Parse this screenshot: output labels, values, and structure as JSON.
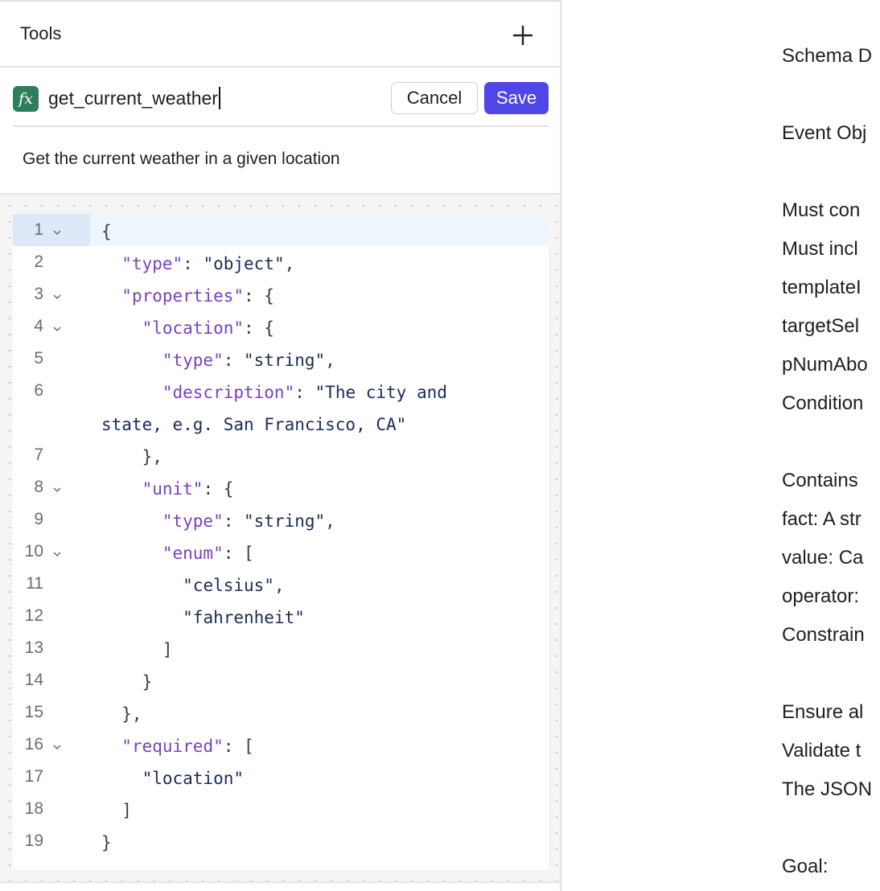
{
  "tools_panel": {
    "title": "Tools",
    "add_icon": "plus-icon",
    "function_icon": "fx-icon",
    "function_icon_glyph": "fx",
    "function_name": "get_current_weather",
    "cancel_label": "Cancel",
    "save_label": "Save",
    "description": "Get the current weather in a given location",
    "accent_color": "#4f46e5",
    "fx_color": "#2e7d5b"
  },
  "code_editor": {
    "lines": [
      {
        "num": "1",
        "fold": true,
        "active": true,
        "tokens": [
          [
            "pun",
            "{"
          ]
        ]
      },
      {
        "num": "2",
        "fold": false,
        "tokens": [
          [
            "pun",
            "  "
          ],
          [
            "key",
            "\"type\""
          ],
          [
            "pun",
            ": "
          ],
          [
            "str",
            "\"object\""
          ],
          [
            "pun",
            ","
          ]
        ]
      },
      {
        "num": "3",
        "fold": true,
        "tokens": [
          [
            "pun",
            "  "
          ],
          [
            "key",
            "\"properties\""
          ],
          [
            "pun",
            ": {"
          ]
        ]
      },
      {
        "num": "4",
        "fold": true,
        "tokens": [
          [
            "pun",
            "    "
          ],
          [
            "key",
            "\"location\""
          ],
          [
            "pun",
            ": {"
          ]
        ]
      },
      {
        "num": "5",
        "fold": false,
        "tokens": [
          [
            "pun",
            "      "
          ],
          [
            "key",
            "\"type\""
          ],
          [
            "pun",
            ": "
          ],
          [
            "str",
            "\"string\""
          ],
          [
            "pun",
            ","
          ]
        ]
      },
      {
        "num": "6",
        "fold": false,
        "tokens": [
          [
            "pun",
            "      "
          ],
          [
            "key",
            "\"description\""
          ],
          [
            "pun",
            ": "
          ],
          [
            "str",
            "\"The city and"
          ]
        ]
      },
      {
        "num": "",
        "fold": false,
        "tokens": [
          [
            "str",
            "state, e.g. San Francisco, CA\""
          ]
        ]
      },
      {
        "num": "7",
        "fold": false,
        "tokens": [
          [
            "pun",
            "    },"
          ]
        ]
      },
      {
        "num": "8",
        "fold": true,
        "tokens": [
          [
            "pun",
            "    "
          ],
          [
            "key",
            "\"unit\""
          ],
          [
            "pun",
            ": {"
          ]
        ]
      },
      {
        "num": "9",
        "fold": false,
        "tokens": [
          [
            "pun",
            "      "
          ],
          [
            "key",
            "\"type\""
          ],
          [
            "pun",
            ": "
          ],
          [
            "str",
            "\"string\""
          ],
          [
            "pun",
            ","
          ]
        ]
      },
      {
        "num": "10",
        "fold": true,
        "tokens": [
          [
            "pun",
            "      "
          ],
          [
            "key",
            "\"enum\""
          ],
          [
            "pun",
            ": ["
          ]
        ]
      },
      {
        "num": "11",
        "fold": false,
        "tokens": [
          [
            "pun",
            "        "
          ],
          [
            "str",
            "\"celsius\""
          ],
          [
            "pun",
            ","
          ]
        ]
      },
      {
        "num": "12",
        "fold": false,
        "tokens": [
          [
            "pun",
            "        "
          ],
          [
            "str",
            "\"fahrenheit\""
          ]
        ]
      },
      {
        "num": "13",
        "fold": false,
        "tokens": [
          [
            "pun",
            "      ]"
          ]
        ]
      },
      {
        "num": "14",
        "fold": false,
        "tokens": [
          [
            "pun",
            "    }"
          ]
        ]
      },
      {
        "num": "15",
        "fold": false,
        "tokens": [
          [
            "pun",
            "  },"
          ]
        ]
      },
      {
        "num": "16",
        "fold": true,
        "tokens": [
          [
            "pun",
            "  "
          ],
          [
            "key",
            "\"required\""
          ],
          [
            "pun",
            ": ["
          ]
        ]
      },
      {
        "num": "17",
        "fold": false,
        "tokens": [
          [
            "pun",
            "    "
          ],
          [
            "str",
            "\"location\""
          ]
        ]
      },
      {
        "num": "18",
        "fold": false,
        "tokens": [
          [
            "pun",
            "  ]"
          ]
        ]
      },
      {
        "num": "19",
        "fold": false,
        "tokens": [
          [
            "pun",
            "}"
          ]
        ]
      }
    ],
    "key_color": "#7b3fc1",
    "string_color": "#1b2a5b"
  },
  "right_panel": {
    "lines": [
      {
        "row": 1,
        "text": "Schema D"
      },
      {
        "row": 3,
        "text": "Event Obj"
      },
      {
        "row": 5,
        "text": "Must con"
      },
      {
        "row": 6,
        "text": "Must incl"
      },
      {
        "row": 7,
        "text": "templateI"
      },
      {
        "row": 8,
        "text": "targetSel"
      },
      {
        "row": 9,
        "text": "pNumAbo"
      },
      {
        "row": 10,
        "text": "Condition"
      },
      {
        "row": 12,
        "text": "Contains"
      },
      {
        "row": 13,
        "text": "fact: A str"
      },
      {
        "row": 14,
        "text": "value: Ca"
      },
      {
        "row": 15,
        "text": "operator:"
      },
      {
        "row": 16,
        "text": "Constrain"
      },
      {
        "row": 18,
        "text": "Ensure al"
      },
      {
        "row": 19,
        "text": "Validate t"
      },
      {
        "row": 20,
        "text": "The JSON"
      },
      {
        "row": 22,
        "text": "Goal:"
      }
    ]
  }
}
